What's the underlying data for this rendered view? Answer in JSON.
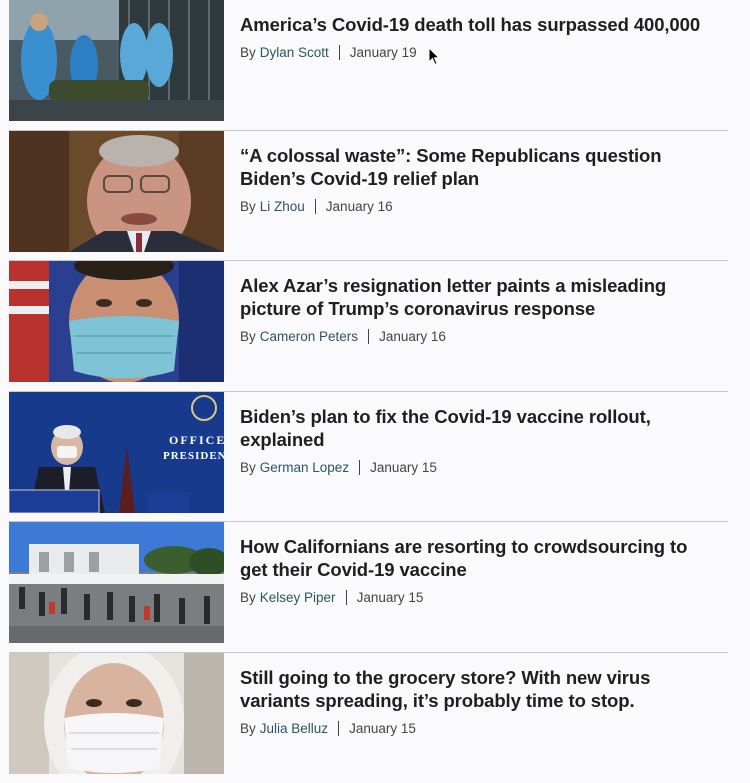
{
  "articles": [
    {
      "headline": "America’s Covid-19 death toll has surpassed 400,000",
      "by": "By",
      "author": "Dylan Scott",
      "date": "January 19",
      "image": "health-workers-photo"
    },
    {
      "headline": "“A colossal waste”: Some Republicans question Biden’s Covid-19 relief plan",
      "by": "By",
      "author": "Li Zhou",
      "date": "January 16",
      "image": "senator-photo"
    },
    {
      "headline": "Alex Azar’s resignation letter paints a misleading picture of Trump’s coronavirus response",
      "by": "By",
      "author": "Cameron Peters",
      "date": "January 16",
      "image": "masked-official-photo"
    },
    {
      "headline": "Biden’s plan to fix the Covid-19 vaccine rollout, explained",
      "by": "By",
      "author": "German Lopez",
      "date": "January 15",
      "image": "biden-podium-photo",
      "image_text": [
        "OFFICE",
        "PRESIDENT"
      ]
    },
    {
      "headline": "How Californians are resorting to crowdsourcing to get their Covid-19 vaccine",
      "by": "By",
      "author": "Kelsey Piper",
      "date": "January 15",
      "image": "vaccine-line-photo"
    },
    {
      "headline": "Still going to the grocery store? With new virus variants spreading, it’s probably time to stop.",
      "by": "By",
      "author": "Julia Belluz",
      "date": "January 15",
      "image": "masked-woman-photo"
    }
  ],
  "colors": {
    "author_link": "#2c5463",
    "headline": "#1f1f1f",
    "divider": "#c8c8c8"
  }
}
